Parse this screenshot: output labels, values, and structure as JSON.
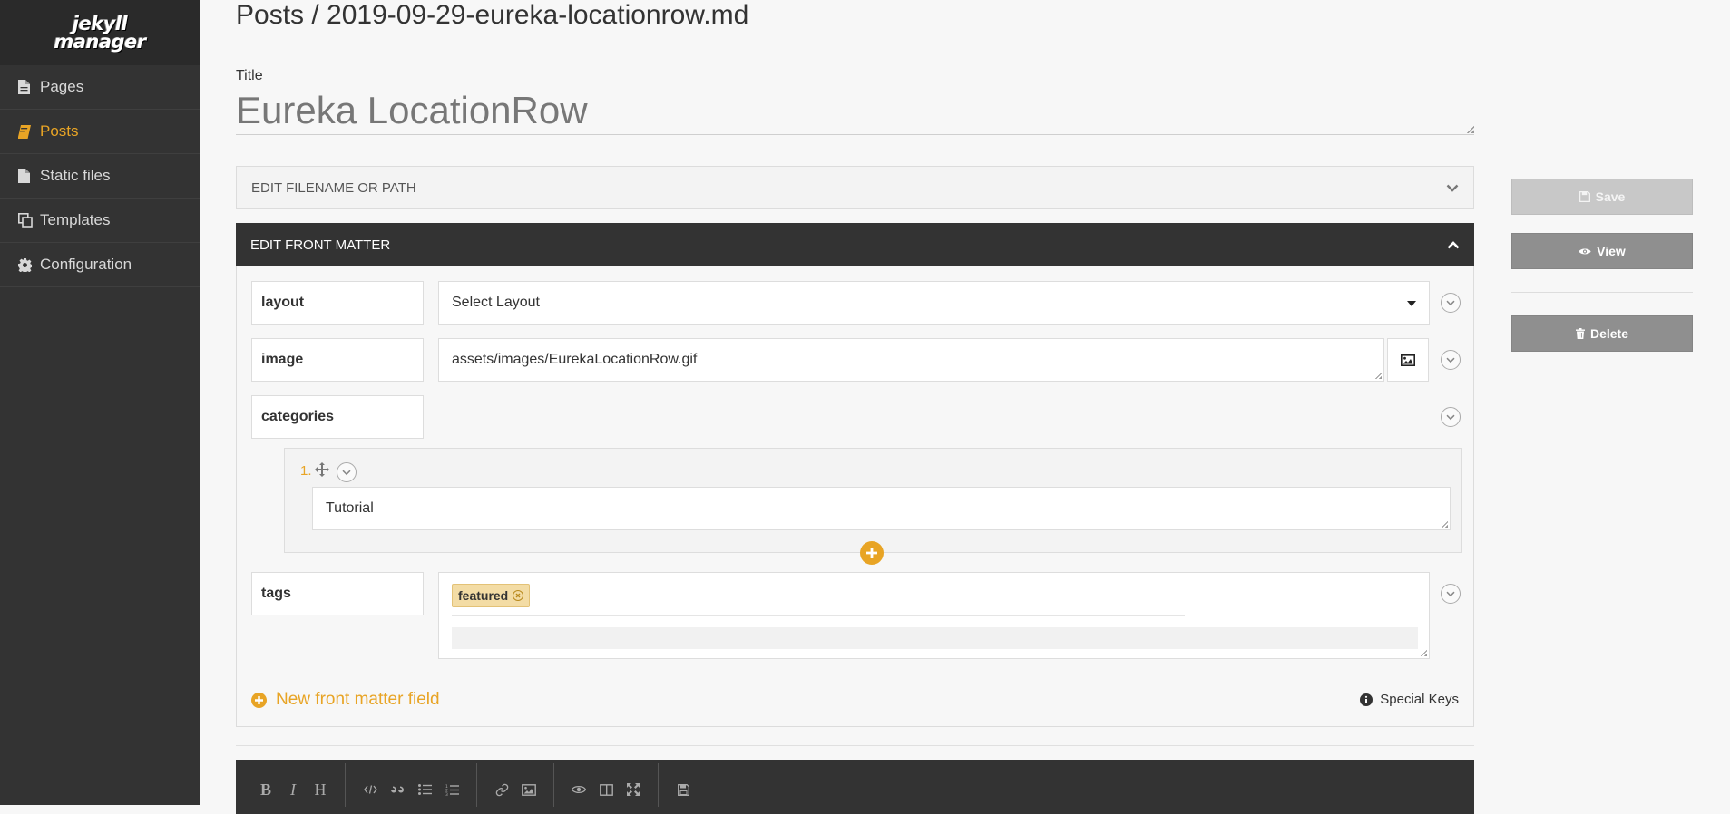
{
  "sidebar": {
    "logo_line1": "jekyll",
    "logo_line2": "manager",
    "items": [
      {
        "label": "Pages",
        "icon": "file-icon"
      },
      {
        "label": "Posts",
        "icon": "book-icon",
        "active": true
      },
      {
        "label": "Static files",
        "icon": "file-icon"
      },
      {
        "label": "Templates",
        "icon": "copy-icon"
      },
      {
        "label": "Configuration",
        "icon": "gear-icon"
      }
    ]
  },
  "header": {
    "breadcrumb": "Posts / 2019-09-29-eureka-locationrow.md",
    "title_label": "Title",
    "title_value": "Eureka LocationRow"
  },
  "panels": {
    "filename": "EDIT FILENAME OR PATH",
    "front_matter": "EDIT FRONT MATTER"
  },
  "front_matter": {
    "layout": {
      "key": "layout",
      "value": "Select Layout"
    },
    "image": {
      "key": "image",
      "value": "assets/images/EurekaLocationRow.gif"
    },
    "categories": {
      "key": "categories",
      "item_number": "1.",
      "item_value": "Tutorial"
    },
    "tags": {
      "key": "tags",
      "tag": "featured"
    },
    "new_field": "New front matter field",
    "special_keys": "Special Keys"
  },
  "actions": {
    "save": "Save",
    "view": "View",
    "delete": "Delete"
  },
  "colors": {
    "accent": "#e8a425",
    "sidebar_bg": "#333333",
    "tag_bg": "#f3dca5"
  }
}
